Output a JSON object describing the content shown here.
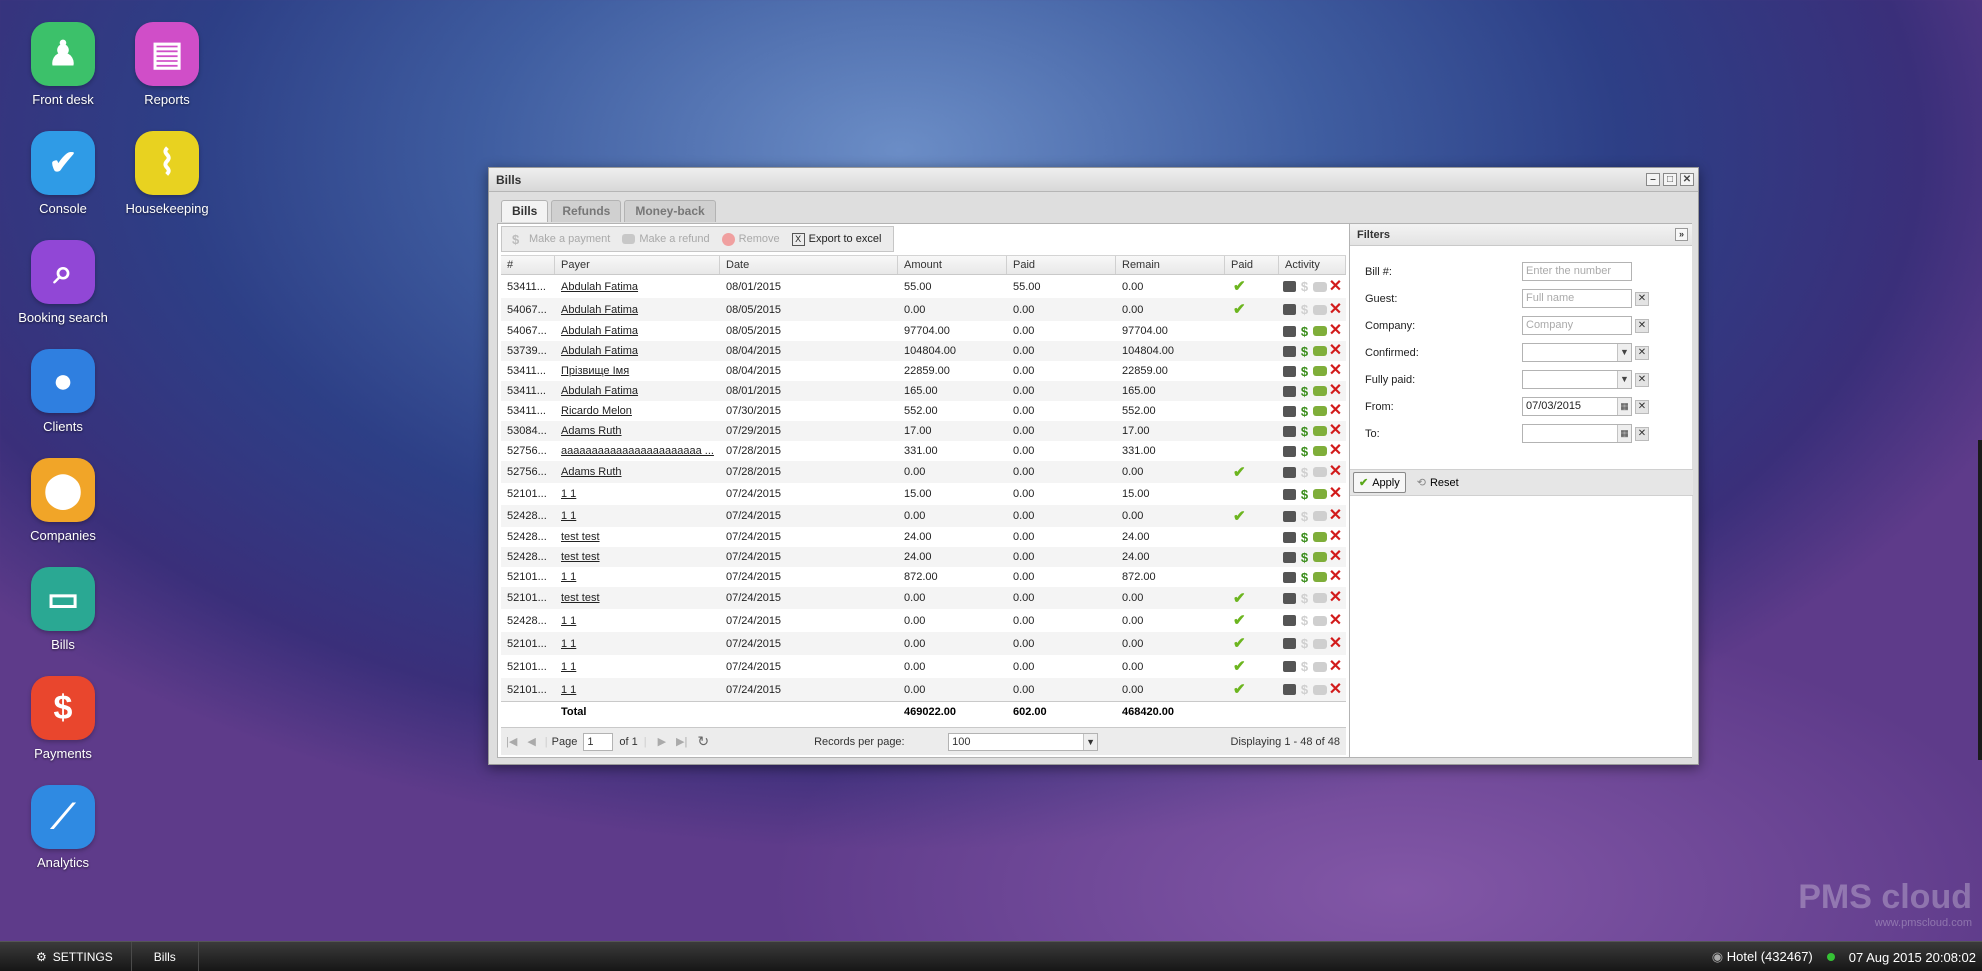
{
  "desktop": {
    "icons": [
      {
        "label": "Front desk",
        "icon": "pawn-icon",
        "color": "#3cc16a"
      },
      {
        "label": "Reports",
        "icon": "books-icon",
        "color": "#d04ec8"
      },
      {
        "label": "Console",
        "icon": "checkmark-icon",
        "color": "#2f9be6"
      },
      {
        "label": "Housekeeping",
        "icon": "broom-icon",
        "color": "#e8d220"
      },
      {
        "label": "Booking search",
        "icon": "magnifier-icon",
        "color": "#9147d6"
      },
      {
        "label": "Clients",
        "icon": "person-icon",
        "color": "#2f7fe0"
      },
      {
        "label": "Companies",
        "icon": "map-pin-icon",
        "color": "#f1a528"
      },
      {
        "label": "Bills",
        "icon": "document-icon",
        "color": "#2aa893"
      },
      {
        "label": "Payments",
        "icon": "dollar-icon",
        "color": "#e9462d"
      },
      {
        "label": "Analytics",
        "icon": "chart-line-icon",
        "color": "#2f8ae2"
      }
    ]
  },
  "window": {
    "title": "Bills",
    "controls": {
      "minimize": "–",
      "maximize": "□",
      "close": "✕"
    },
    "tabs": [
      {
        "label": "Bills",
        "active": true
      },
      {
        "label": "Refunds",
        "active": false
      },
      {
        "label": "Money-back",
        "active": false
      }
    ]
  },
  "toolbar": {
    "make_payment": "Make a payment",
    "make_refund": "Make a refund",
    "remove": "Remove",
    "export": "Export to excel"
  },
  "grid": {
    "columns": [
      "#",
      "Payer",
      "Date",
      "Amount",
      "Paid",
      "Remain",
      "Paid",
      "Activity"
    ],
    "rows": [
      {
        "num": "53411...",
        "payer": "Abdulah Fatima",
        "date": "08/01/2015",
        "amount": "55.00",
        "paid": "55.00",
        "remain": "0.00",
        "fully_paid": true,
        "pay_enabled": false
      },
      {
        "num": "54067...",
        "payer": "Abdulah Fatima",
        "date": "08/05/2015",
        "amount": "0.00",
        "paid": "0.00",
        "remain": "0.00",
        "fully_paid": true,
        "pay_enabled": false
      },
      {
        "num": "54067...",
        "payer": "Abdulah Fatima",
        "date": "08/05/2015",
        "amount": "97704.00",
        "paid": "0.00",
        "remain": "97704.00",
        "fully_paid": false,
        "pay_enabled": true
      },
      {
        "num": "53739...",
        "payer": "Abdulah Fatima",
        "date": "08/04/2015",
        "amount": "104804.00",
        "paid": "0.00",
        "remain": "104804.00",
        "fully_paid": false,
        "pay_enabled": true
      },
      {
        "num": "53411...",
        "payer": "Прізвище Імя",
        "date": "08/04/2015",
        "amount": "22859.00",
        "paid": "0.00",
        "remain": "22859.00",
        "fully_paid": false,
        "pay_enabled": true
      },
      {
        "num": "53411...",
        "payer": "Abdulah Fatima",
        "date": "08/01/2015",
        "amount": "165.00",
        "paid": "0.00",
        "remain": "165.00",
        "fully_paid": false,
        "pay_enabled": true
      },
      {
        "num": "53411...",
        "payer": "Ricardo Melon",
        "date": "07/30/2015",
        "amount": "552.00",
        "paid": "0.00",
        "remain": "552.00",
        "fully_paid": false,
        "pay_enabled": true
      },
      {
        "num": "53084...",
        "payer": "Adams Ruth",
        "date": "07/29/2015",
        "amount": "17.00",
        "paid": "0.00",
        "remain": "17.00",
        "fully_paid": false,
        "pay_enabled": true
      },
      {
        "num": "52756...",
        "payer": "aaaaaaaaaaaaaaaaaaaaaaa ...",
        "date": "07/28/2015",
        "amount": "331.00",
        "paid": "0.00",
        "remain": "331.00",
        "fully_paid": false,
        "pay_enabled": true
      },
      {
        "num": "52756...",
        "payer": "Adams Ruth",
        "date": "07/28/2015",
        "amount": "0.00",
        "paid": "0.00",
        "remain": "0.00",
        "fully_paid": true,
        "pay_enabled": false
      },
      {
        "num": "52101...",
        "payer": "1 1",
        "date": "07/24/2015",
        "amount": "15.00",
        "paid": "0.00",
        "remain": "15.00",
        "fully_paid": false,
        "pay_enabled": true
      },
      {
        "num": "52428...",
        "payer": "1 1",
        "date": "07/24/2015",
        "amount": "0.00",
        "paid": "0.00",
        "remain": "0.00",
        "fully_paid": true,
        "pay_enabled": false
      },
      {
        "num": "52428...",
        "payer": "test test",
        "date": "07/24/2015",
        "amount": "24.00",
        "paid": "0.00",
        "remain": "24.00",
        "fully_paid": false,
        "pay_enabled": true
      },
      {
        "num": "52428...",
        "payer": "test test",
        "date": "07/24/2015",
        "amount": "24.00",
        "paid": "0.00",
        "remain": "24.00",
        "fully_paid": false,
        "pay_enabled": true
      },
      {
        "num": "52101...",
        "payer": "1 1",
        "date": "07/24/2015",
        "amount": "872.00",
        "paid": "0.00",
        "remain": "872.00",
        "fully_paid": false,
        "pay_enabled": true
      },
      {
        "num": "52101...",
        "payer": "test test",
        "date": "07/24/2015",
        "amount": "0.00",
        "paid": "0.00",
        "remain": "0.00",
        "fully_paid": true,
        "pay_enabled": false
      },
      {
        "num": "52428...",
        "payer": "1 1",
        "date": "07/24/2015",
        "amount": "0.00",
        "paid": "0.00",
        "remain": "0.00",
        "fully_paid": true,
        "pay_enabled": false
      },
      {
        "num": "52101...",
        "payer": "1 1",
        "date": "07/24/2015",
        "amount": "0.00",
        "paid": "0.00",
        "remain": "0.00",
        "fully_paid": true,
        "pay_enabled": false
      },
      {
        "num": "52101...",
        "payer": "1 1",
        "date": "07/24/2015",
        "amount": "0.00",
        "paid": "0.00",
        "remain": "0.00",
        "fully_paid": true,
        "pay_enabled": false
      },
      {
        "num": "52101...",
        "payer": "1 1",
        "date": "07/24/2015",
        "amount": "0.00",
        "paid": "0.00",
        "remain": "0.00",
        "fully_paid": true,
        "pay_enabled": false
      }
    ],
    "total": {
      "label": "Total",
      "amount": "469022.00",
      "paid": "602.00",
      "remain": "468420.00"
    }
  },
  "pager": {
    "page_label": "Page",
    "page_value": "1",
    "of_label": "of 1",
    "rpp_label": "Records per page:",
    "rpp_value": "100",
    "displaying": "Displaying 1 - 48 of 48"
  },
  "filters": {
    "title": "Filters",
    "bill_label": "Bill #:",
    "bill_placeholder": "Enter the number",
    "guest_label": "Guest:",
    "guest_placeholder": "Full name",
    "company_label": "Company:",
    "company_placeholder": "Company",
    "confirmed_label": "Confirmed:",
    "fully_paid_label": "Fully paid:",
    "from_label": "From:",
    "from_value": "07/03/2015",
    "to_label": "To:",
    "apply": "Apply",
    "reset": "Reset"
  },
  "taskbar": {
    "settings": "SETTINGS",
    "open_window": "Bills",
    "hotel": "Hotel (432467)",
    "datetime": "07 Aug 2015 20:08:02"
  },
  "brand": {
    "logo": "PMS cloud",
    "url": "www.pmscloud.com"
  }
}
